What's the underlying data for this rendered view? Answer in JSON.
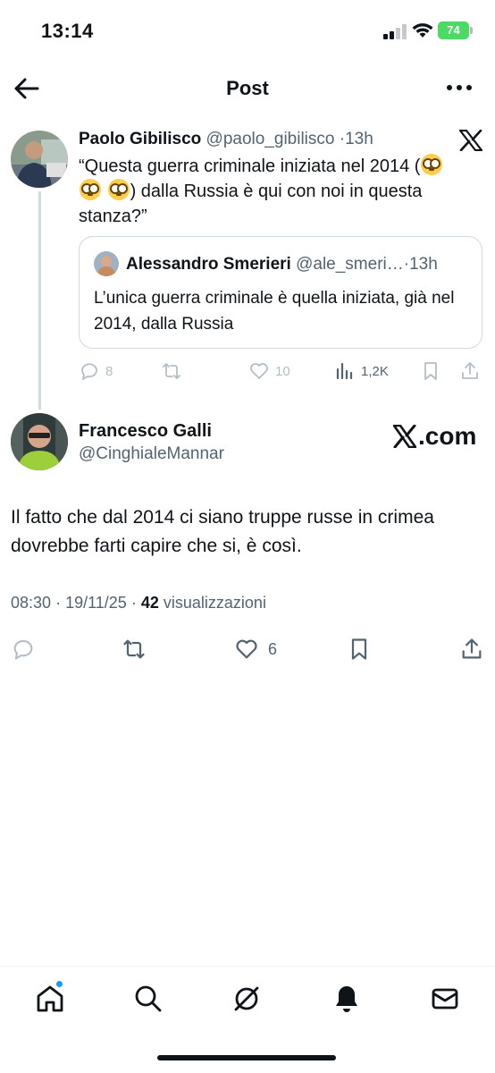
{
  "status_bar": {
    "time": "13:14",
    "battery": "74"
  },
  "header": {
    "title": "Post",
    "back_icon": "arrow-left-icon",
    "more_icon": "more-horizontal-icon"
  },
  "parent_post": {
    "author_name": "Paolo Gibilisco",
    "author_handle": "@paolo_gibilisco",
    "separator": "·",
    "time": "13h",
    "text_part1": "“Questa guerra criminale iniziata nel 2014 (",
    "text_part2": ") dalla Russia è qui con noi in questa stanza?”",
    "quoted": {
      "author_name": "Alessandro Smerieri",
      "author_handle": "@ale_smeri…",
      "separator": "·",
      "time": "13h",
      "text": "L’unica guerra criminale è quella iniziata, già nel 2014, dalla Russia"
    },
    "actions": {
      "replies": "8",
      "reposts": "",
      "likes": "10",
      "views": "1,2K"
    }
  },
  "main_post": {
    "author_name": "Francesco Galli",
    "author_handle": "@CinghialeMannar",
    "watermark": ".com",
    "text": "Il fatto che dal 2014 ci siano truppe russe in crimea dovrebbe farti capire che si, è così.",
    "time": "08:30",
    "date": "19/11/25",
    "separator": "·",
    "views_count": "42",
    "views_label": "visualizzazioni",
    "actions": {
      "likes": "6"
    }
  },
  "colors": {
    "accent": "#1d9bf0",
    "secondary_text": "#536471",
    "border": "#cfd9de"
  }
}
